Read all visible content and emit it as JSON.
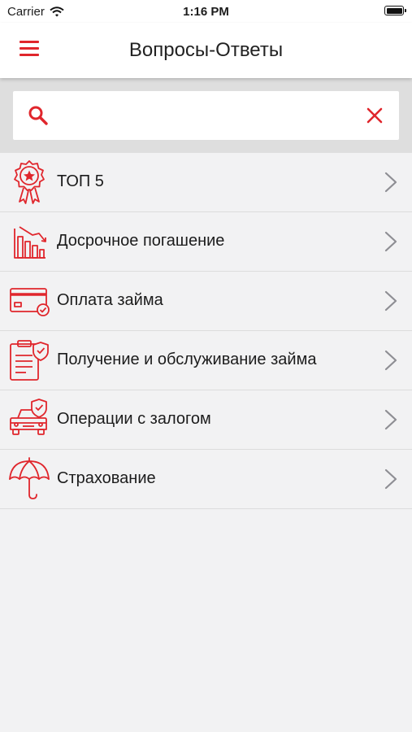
{
  "status_bar": {
    "carrier": "Carrier",
    "time": "1:16 PM"
  },
  "nav": {
    "title": "Вопросы-Ответы",
    "menu_icon": "hamburger-menu-icon"
  },
  "search": {
    "value": "",
    "placeholder": "",
    "search_icon": "search-icon",
    "clear_icon": "close-icon"
  },
  "colors": {
    "accent": "#e0262c",
    "background": "#f2f2f3",
    "chevron": "#8e8e93"
  },
  "list": {
    "items": [
      {
        "label": "ТОП 5",
        "icon": "award-ribbon-icon"
      },
      {
        "label": "Досрочное погашение",
        "icon": "declining-bar-chart-icon"
      },
      {
        "label": "Оплата займа",
        "icon": "credit-card-check-icon"
      },
      {
        "label": "Получение и обслуживание займа",
        "icon": "clipboard-shield-icon"
      },
      {
        "label": "Операции с залогом",
        "icon": "car-shield-icon"
      },
      {
        "label": "Страхование",
        "icon": "umbrella-icon"
      }
    ]
  }
}
